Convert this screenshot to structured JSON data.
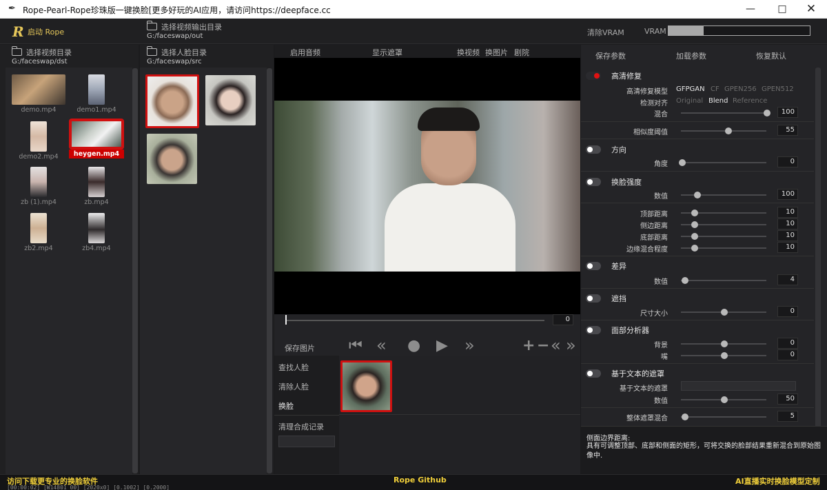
{
  "window": {
    "title": "Rope-Pearl-Rope珍珠版一键换脸[更多好玩的AI应用，请访问https://deepface.cc"
  },
  "topbar": {
    "start_label": "启动 Rope",
    "output_folder_label": "选择视频输出目录",
    "output_folder_path": "G:/faceswap/out",
    "clear_vram_label": "清除VRAM",
    "vram_label": "VRAM",
    "vram_fraction": 0.25
  },
  "video_panel": {
    "folder_label": "选择视频目录",
    "folder_path": "G:/faceswap/dst",
    "items": [
      {
        "name": "demo.mp4"
      },
      {
        "name": "demo1.mp4"
      },
      {
        "name": "demo2.mp4"
      },
      {
        "name": "heygen.mp4",
        "selected": true
      },
      {
        "name": "zb (1).mp4"
      },
      {
        "name": "zb.mp4"
      },
      {
        "name": "zb2.mp4"
      },
      {
        "name": "zb4.mp4"
      }
    ]
  },
  "face_panel": {
    "folder_label": "选择人脸目录",
    "folder_path": "G:/faceswap/src"
  },
  "preview_toolbar": {
    "audio": "启用音频",
    "show_mask": "显示遮罩",
    "swap_video": "换视频",
    "swap_image": "换图片",
    "theater": "剧院"
  },
  "timeline": {
    "frame_value": "0"
  },
  "player": {
    "save_image": "保存图片"
  },
  "actions": {
    "find_faces": "查找人脸",
    "clear_faces": "清除人脸",
    "swap_faces": "换脸",
    "clear_merge_history": "清理合成记录"
  },
  "params_toolbar": {
    "save": "保存参数",
    "load": "加载参数",
    "reset": "恢复默认"
  },
  "restore": {
    "title": "高清修复",
    "model_label": "高清修复模型",
    "models": [
      "GFPGAN",
      "CF",
      "GPEN256",
      "GPEN512"
    ],
    "detect_label": "检测对齐",
    "detect_options": [
      "Original",
      "Blend",
      "Reference"
    ],
    "blend_label": "混合",
    "blend_value": "100",
    "similarity_label": "相似度阈值",
    "similarity_value": "55"
  },
  "orientation": {
    "title": "方向",
    "angle_label": "角度",
    "angle_value": "0"
  },
  "swap_strength": {
    "title": "换脸强度",
    "value_label": "数值",
    "value": "100",
    "top_label": "顶部距离",
    "top_value": "10",
    "side_label": "侧边距离",
    "side_value": "10",
    "bottom_label": "底部距离",
    "bottom_value": "10",
    "edge_label": "边缘混合程度",
    "edge_value": "10"
  },
  "diff": {
    "title": "差异",
    "value_label": "数值",
    "value": "4"
  },
  "occlusion": {
    "title": "遮挡",
    "size_label": "尺寸大小",
    "size_value": "0"
  },
  "face_parser": {
    "title": "面部分析器",
    "bg_label": "背景",
    "bg_value": "0",
    "mouth_label": "嘴",
    "mouth_value": "0"
  },
  "text_mask": {
    "title": "基于文本的遮罩",
    "text_label": "基于文本的遮罩",
    "value_label": "数值",
    "value": "50"
  },
  "overall_mask": {
    "label": "整体遮罩混合",
    "value": "5"
  },
  "help": {
    "title": "侧面边界距离:",
    "body": "具有可调整顶部、底部和侧面的矩形，可将交换的脸部结果重新混合到原始图像中."
  },
  "footer": {
    "left": "访问下载更专业的换脸软件",
    "center": "Rope Github",
    "right": "AI直播实时换脸模型定制",
    "console": "[00:00:02] [W14801 00] [2020x0] [0.1002] [0.2000]"
  },
  "colors": {
    "accent": "#d01010",
    "title_yellow": "#e6c75a",
    "footer_yellow": "#f0cf3a"
  }
}
